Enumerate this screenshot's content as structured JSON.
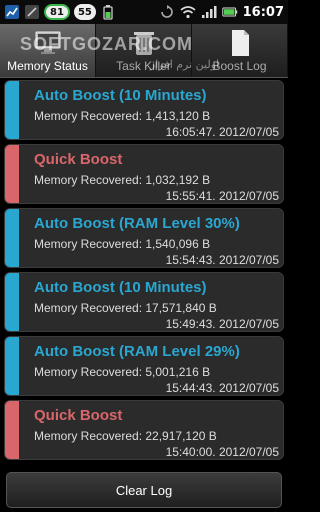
{
  "status_bar": {
    "battery_level": "81",
    "badge_count": "55",
    "clock": "16:07",
    "icons": [
      "app-chart-icon",
      "usb-icon",
      "battery-status-icon",
      "sync-icon",
      "wifi-icon",
      "signal-icon",
      "battery-icon"
    ]
  },
  "tabs": [
    {
      "label": "Memory Status",
      "icon": "monitor-icon",
      "active": true
    },
    {
      "label": "Task Killer",
      "icon": "trash-icon",
      "active": false
    },
    {
      "label": "Boost Log",
      "icon": "document-icon",
      "active": false
    }
  ],
  "watermark": {
    "text": "SOFTGOZAR.COM",
    "subtext": "اولین نرم افزار"
  },
  "log_entries": [
    {
      "title": "Auto Boost (10 Minutes)",
      "memory": "Memory Recovered: 1,413,120 B",
      "time": "16:05:47. 2012/07/05",
      "kind": "auto"
    },
    {
      "title": "Quick Boost",
      "memory": "Memory Recovered: 1,032,192 B",
      "time": "15:55:41. 2012/07/05",
      "kind": "quick"
    },
    {
      "title": "Auto Boost (RAM Level 30%)",
      "memory": "Memory Recovered: 1,540,096 B",
      "time": "15:54:43. 2012/07/05",
      "kind": "auto"
    },
    {
      "title": "Auto Boost (10 Minutes)",
      "memory": "Memory Recovered: 17,571,840 B",
      "time": "15:49:43. 2012/07/05",
      "kind": "auto"
    },
    {
      "title": "Auto Boost (RAM Level 29%)",
      "memory": "Memory Recovered: 5,001,216 B",
      "time": "15:44:43. 2012/07/05",
      "kind": "auto"
    },
    {
      "title": "Quick Boost",
      "memory": "Memory Recovered: 22,917,120 B",
      "time": "15:40:00. 2012/07/05",
      "kind": "quick"
    }
  ],
  "colors": {
    "auto": "#2aa7d0",
    "quick": "#d9666b"
  },
  "footer": {
    "clear_label": "Clear Log"
  }
}
